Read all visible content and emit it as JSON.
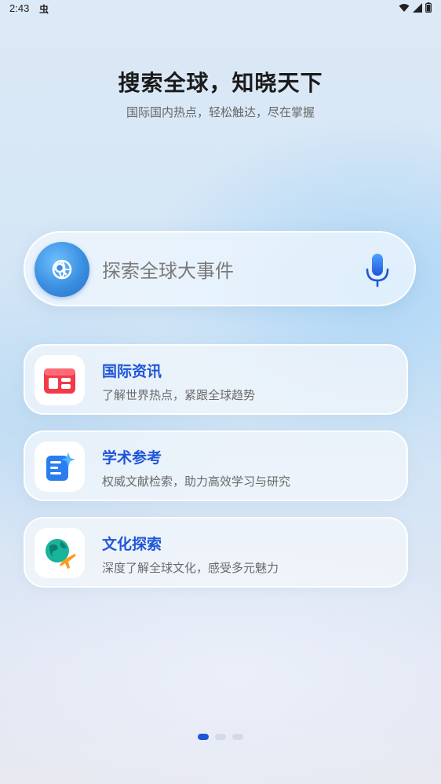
{
  "status": {
    "time": "2:43",
    "app_glyph": "虫"
  },
  "hero": {
    "title": "搜索全球，知晓天下",
    "subtitle": "国际国内热点，轻松触达，尽在掌握"
  },
  "search": {
    "placeholder": "探索全球大事件",
    "left_icon": "globe-search-icon",
    "right_icon": "microphone-icon"
  },
  "cards": [
    {
      "title": "国际资讯",
      "desc": "了解世界热点，紧跟全球趋势",
      "icon": "news-icon",
      "color": "#f23a4a"
    },
    {
      "title": "学术参考",
      "desc": "权威文献检索，助力高效学习与研究",
      "icon": "academic-doc-icon",
      "color": "#2a7df0"
    },
    {
      "title": "文化探索",
      "desc": "深度了解全球文化，感受多元魅力",
      "icon": "globe-travel-icon",
      "color": "#19b39a"
    }
  ],
  "pager": {
    "count": 3,
    "active": 0
  },
  "colors": {
    "accent": "#1f56d8",
    "card_title": "#1f56d8"
  }
}
